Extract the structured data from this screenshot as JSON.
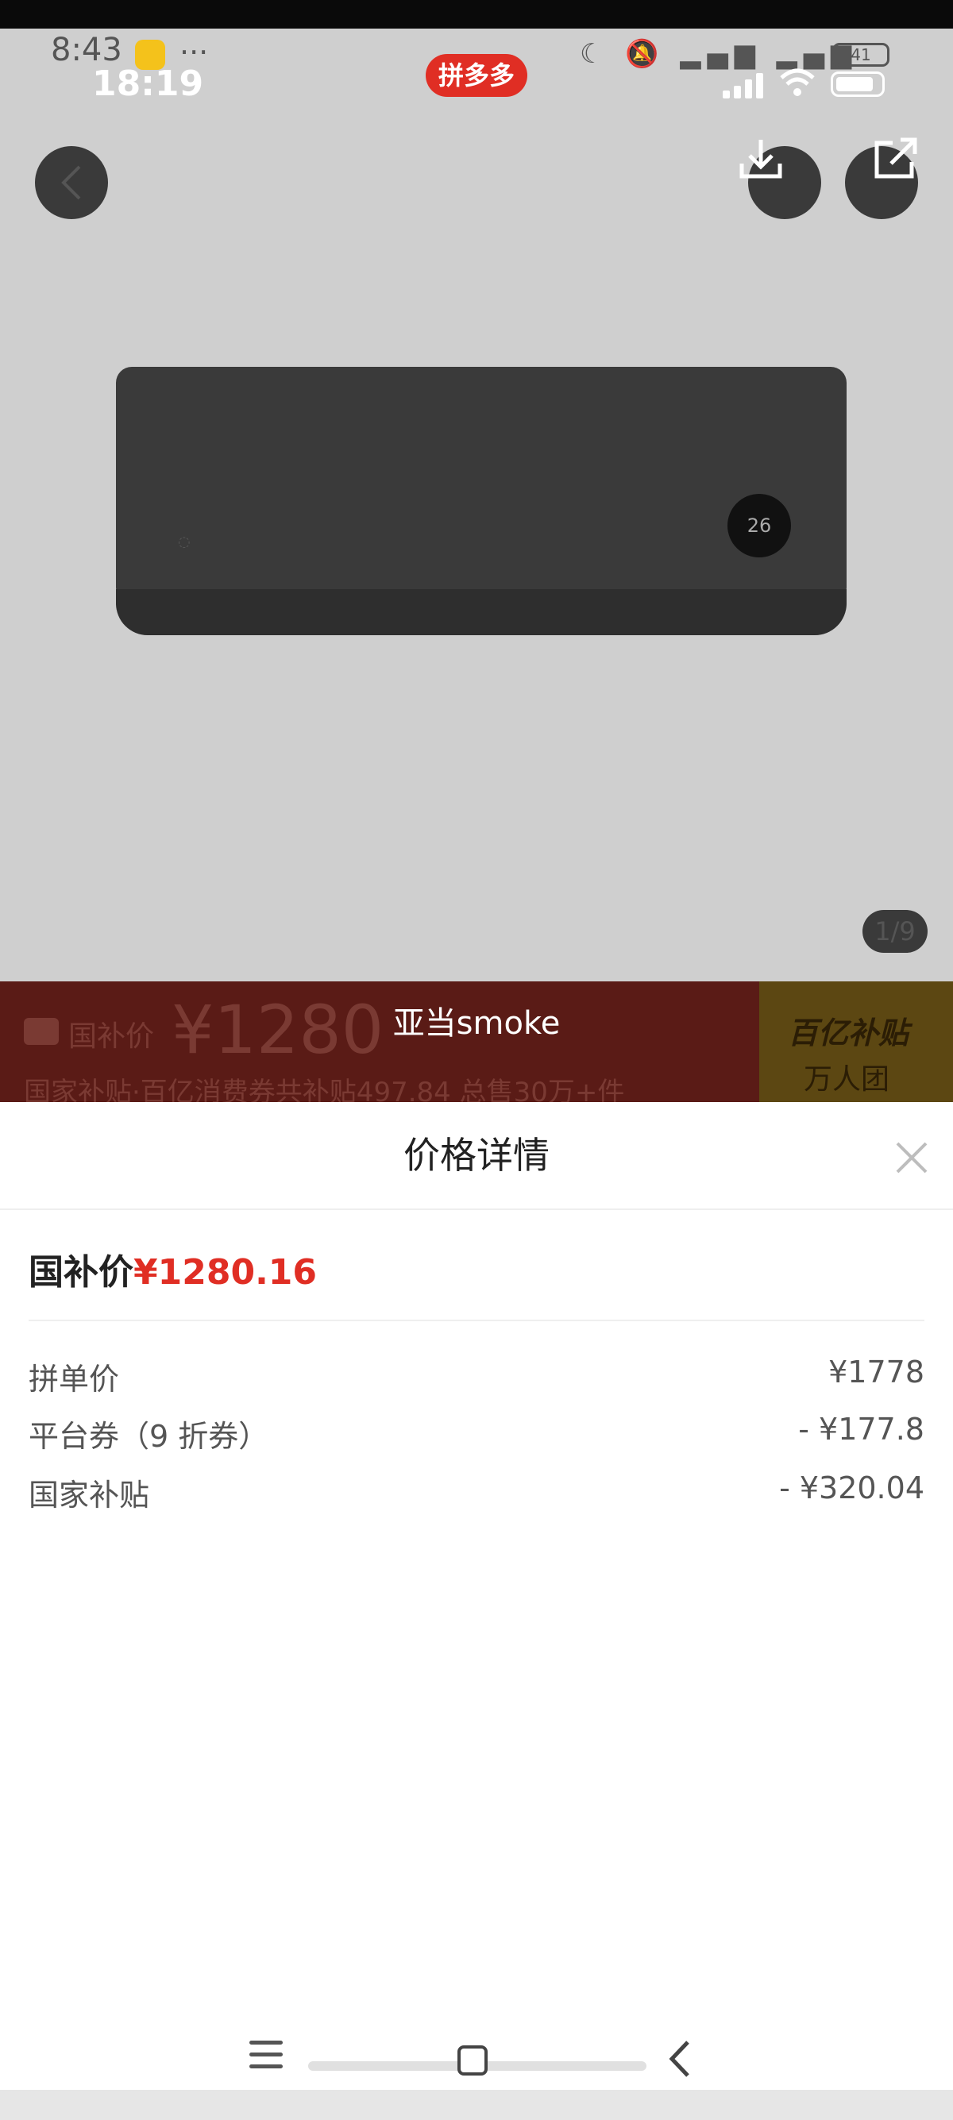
{
  "status": {
    "time_small": "8:43",
    "time": "18:19",
    "dots": "···",
    "app_badge": "拼多多",
    "battery_small": "41"
  },
  "toolbar": {
    "back_icon": "chevron-left-icon",
    "download_icon": "download-icon",
    "share_icon": "share-icon"
  },
  "gallery": {
    "counter": "1/9",
    "display_text": "26"
  },
  "banner": {
    "label": "国补价",
    "price": "¥1280",
    "sub": "国家补贴·百亿消费券共补贴497.84  总售30万+件",
    "right_title": "百亿补贴",
    "right_sub": "万人团",
    "toast": "亚当smoke"
  },
  "sheet": {
    "title": "价格详情",
    "close_icon": "close-icon",
    "summary_label": "国补价",
    "summary_price": "¥1280.16",
    "rows": [
      {
        "label": "拼单价",
        "value": "¥1778"
      },
      {
        "label": "平台券（9 折券）",
        "value": "- ¥177.8"
      },
      {
        "label": "国家补贴",
        "value": "- ¥320.04"
      }
    ]
  },
  "colors": {
    "accent": "#e02e24",
    "overlay": "#3f3f3f"
  }
}
